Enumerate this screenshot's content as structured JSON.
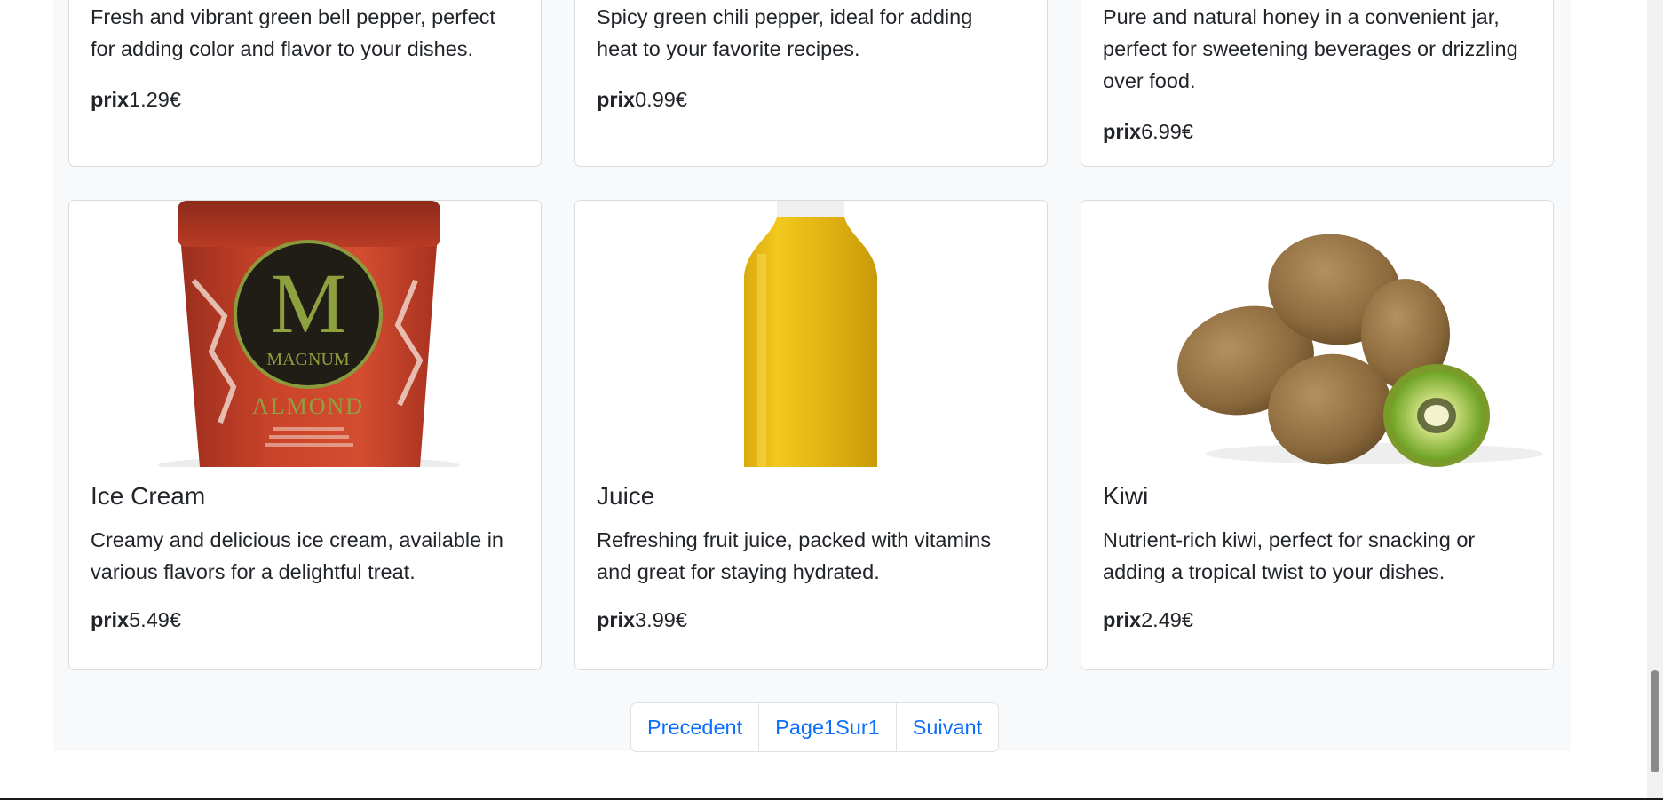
{
  "top_row": [
    {
      "description": "Fresh and vibrant green bell pepper, perfect for adding color and flavor to your dishes.",
      "price_label": "prix",
      "price_value": "1.29€"
    },
    {
      "description": "Spicy green chili pepper, ideal for adding heat to your favorite recipes.",
      "price_label": "prix",
      "price_value": "0.99€"
    },
    {
      "description": "Pure and natural honey in a convenient jar, perfect for sweetening beverages or drizzling over food.",
      "price_label": "prix",
      "price_value": "6.99€"
    }
  ],
  "products": [
    {
      "title": "Ice Cream",
      "image_icon": "ice-cream-tub-image",
      "image_text": [
        "MAGNUM",
        "ALMOND",
        "M"
      ],
      "description": "Creamy and delicious ice cream, available in various flavors for a delightful treat.",
      "price_label": "prix",
      "price_value": "5.49€"
    },
    {
      "title": "Juice",
      "image_icon": "juice-bottle-image",
      "description": "Refreshing fruit juice, packed with vitamins and great for staying hydrated.",
      "price_label": "prix",
      "price_value": "3.99€"
    },
    {
      "title": "Kiwi",
      "image_icon": "kiwi-fruit-image",
      "description": "Nutrient-rich kiwi, perfect for snacking or adding a tropical twist to your dishes.",
      "price_label": "prix",
      "price_value": "2.49€"
    }
  ],
  "pagination": {
    "previous_label": "Precedent",
    "current_label": "Page1Sur1",
    "next_label": "Suivant"
  },
  "colors": {
    "link": "#0d6efd",
    "background": "#f8f9fa",
    "card_border": "#d9dcdf"
  }
}
